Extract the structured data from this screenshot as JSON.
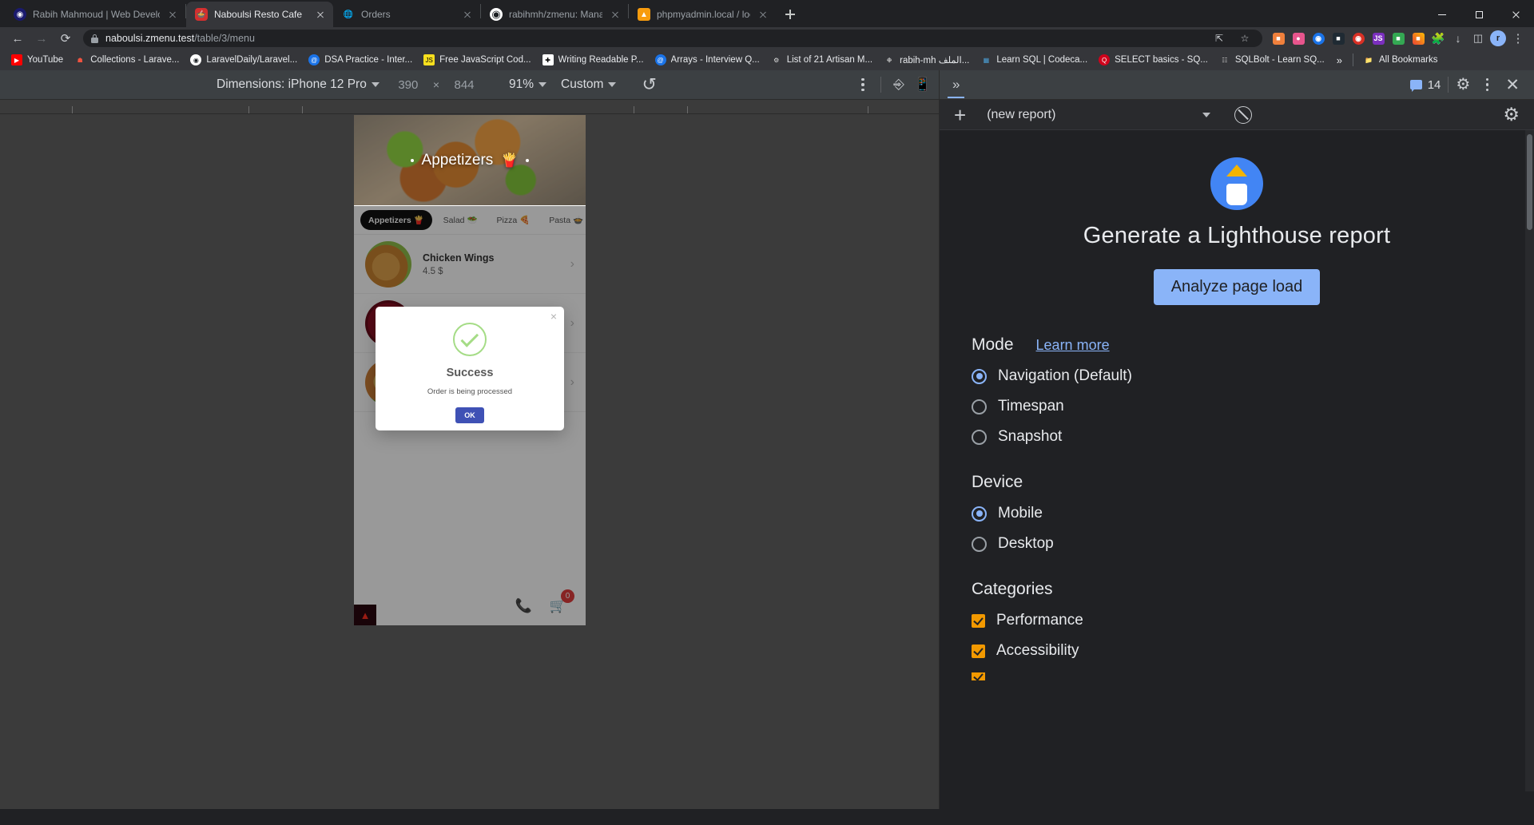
{
  "browser": {
    "tabs": [
      {
        "title": "Rabih Mahmoud | Web Develop",
        "favicon": "globe-blue-icon",
        "active": false
      },
      {
        "title": "Naboulsi Resto Cafe",
        "favicon": "resto-icon",
        "active": true
      },
      {
        "title": "Orders",
        "favicon": "globe-icon",
        "active": false
      },
      {
        "title": "rabihmh/zmenu: Manage your re",
        "favicon": "github-icon",
        "active": false
      },
      {
        "title": "phpmyadmin.local / localhost / t",
        "favicon": "phpmyadmin-icon",
        "active": false
      }
    ],
    "new_tab_label": "+",
    "window_controls": {
      "minimize": "minimize-icon",
      "maximize": "maximize-icon",
      "close": "close-icon"
    },
    "nav": {
      "back": "back-arrow-icon",
      "forward": "forward-arrow-icon",
      "reload": "reload-icon"
    },
    "omnibox": {
      "lock": "lock-icon",
      "domain": "naboulsi.zmenu.test",
      "path": "/table/3/menu",
      "share_icon": "share-icon",
      "star_icon": "star-icon"
    },
    "toolbar_icons": [
      "extension-orange-icon",
      "extension-pink-icon",
      "extension-blue-globe-icon",
      "extension-dark-icon",
      "extension-red-icon",
      "extension-js-purple-icon",
      "extension-green-icon",
      "extension-colorful-icon",
      "puzzle-icon",
      "download-icon",
      "sidepanel-icon"
    ],
    "profile_initial": "r",
    "chrome_menu": "kebab-menu-icon",
    "bookmarks": [
      {
        "label": "YouTube",
        "icon": "youtube-icon",
        "color": "#ff0000"
      },
      {
        "label": "Collections - Larave...",
        "icon": "laravel-news-icon",
        "color": "#f05340"
      },
      {
        "label": "LaravelDaily/Laravel...",
        "icon": "github-icon",
        "color": "#ffffff"
      },
      {
        "label": "DSA Practice - Inter...",
        "icon": "at-blue-icon",
        "color": "#1a73e8"
      },
      {
        "label": "Free JavaScript Cod...",
        "icon": "js-icon",
        "color": "#f7df1e"
      },
      {
        "label": "Writing Readable P...",
        "icon": "plus-white-icon",
        "color": "#ffffff"
      },
      {
        "label": "Arrays - Interview Q...",
        "icon": "at-blue-icon",
        "color": "#1a73e8"
      },
      {
        "label": "List of 21 Artisan M...",
        "icon": "artisan-icon",
        "color": "#bdbdbd"
      },
      {
        "label": "rabih-mh الملف...",
        "icon": "swirl-icon",
        "color": "#dddddd"
      },
      {
        "label": "Learn SQL | Codeca...",
        "icon": "codecademy-icon",
        "color": "#4b9fd5"
      },
      {
        "label": "SELECT basics - SQ...",
        "icon": "sql-red-icon",
        "color": "#d0021b"
      },
      {
        "label": "SQLBolt - Learn SQ...",
        "icon": "database-icon",
        "color": "#cccccc"
      }
    ],
    "bookmarks_overflow": "»",
    "all_bookmarks": {
      "label": "All Bookmarks",
      "icon": "folder-icon"
    }
  },
  "device_toolbar": {
    "dimensions_label": "Dimensions: iPhone 12 Pro",
    "width": "390",
    "times": "×",
    "height": "844",
    "zoom": "91%",
    "throttling": "Custom",
    "rotate_icon": "rotate-device-icon",
    "more_icon": "kebab-menu-icon",
    "inspect_icon": "inspect-element-icon",
    "device_icon": "toggle-device-toolbar-icon"
  },
  "devtools": {
    "overflow_tabs": "»",
    "message_count": "14",
    "message_icon": "console-message-icon",
    "settings_icon": "gear-icon",
    "more_icon": "kebab-menu-icon",
    "close_icon": "close-icon"
  },
  "lighthouse": {
    "new_button": "+",
    "report_select": "(new report)",
    "report_caret": "chevron-down-icon",
    "clear_icon": "clear-all-icon",
    "settings_icon": "gear-icon",
    "logo": "lighthouse-logo-icon",
    "heading": "Generate a Lighthouse report",
    "analyze_button": "Analyze page load",
    "mode": {
      "title": "Mode",
      "learn_more": "Learn more",
      "options": [
        {
          "label": "Navigation (Default)",
          "selected": true
        },
        {
          "label": "Timespan",
          "selected": false
        },
        {
          "label": "Snapshot",
          "selected": false
        }
      ]
    },
    "device": {
      "title": "Device",
      "options": [
        {
          "label": "Mobile",
          "selected": true
        },
        {
          "label": "Desktop",
          "selected": false
        }
      ]
    },
    "categories": {
      "title": "Categories",
      "options": [
        {
          "label": "Performance",
          "checked": true
        },
        {
          "label": "Accessibility",
          "checked": true
        }
      ]
    },
    "accent_color": "#8ab4f8",
    "checkbox_color": "#f29900"
  },
  "page": {
    "hero": {
      "dot_left": "•",
      "title": "Appetizers",
      "emoji": "🍟",
      "dot_right": "•"
    },
    "categories": [
      {
        "label": "Appetizers 🍟",
        "active": true
      },
      {
        "label": "Salad 🥗",
        "active": false
      },
      {
        "label": "Pizza 🍕",
        "active": false
      },
      {
        "label": "Pasta 🍲",
        "active": false
      }
    ],
    "items": [
      {
        "name": "Chicken Wings",
        "price": "4.5 $",
        "chevron": "chevron-right-icon"
      },
      {
        "name": "",
        "price": "",
        "chevron": "chevron-right-icon"
      },
      {
        "name": "",
        "price": "",
        "chevron": "chevron-right-icon"
      }
    ],
    "footer": {
      "phone_icon": "phone-icon",
      "cart_icon": "cart-icon",
      "cart_count": "0",
      "laravel_icon": "laravel-icon"
    },
    "modal": {
      "close": "×",
      "check_icon": "success-check-icon",
      "title": "Success",
      "message": "Order is being processed",
      "ok_label": "OK"
    }
  }
}
